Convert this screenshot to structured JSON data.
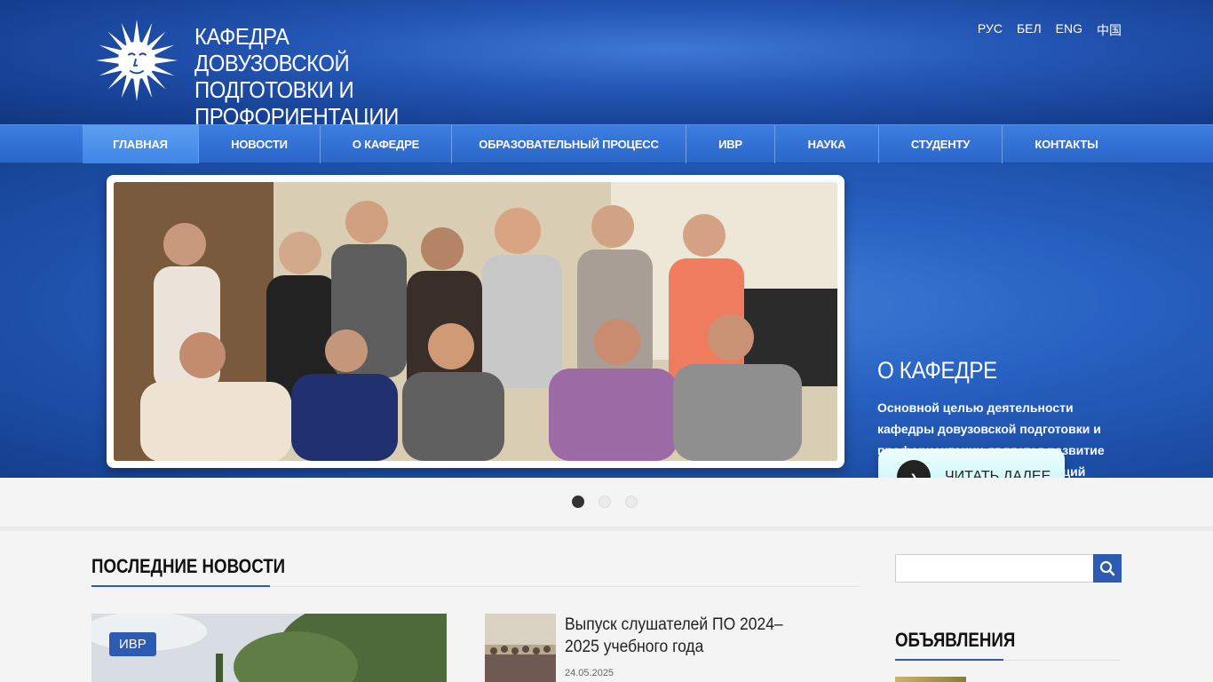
{
  "header": {
    "title_lines": [
      "КАФЕДРА ДОВУЗОВСКОЙ",
      "ПОДГОТОВКИ И",
      "ПРОФОРИЕНТАЦИИ"
    ],
    "languages": [
      "РУС",
      "БЕЛ",
      "ENG",
      "中国"
    ]
  },
  "nav": {
    "items": [
      {
        "label": "ГЛАВНАЯ",
        "active": true
      },
      {
        "label": "НОВОСТИ"
      },
      {
        "label": "О КАФЕДРЕ"
      },
      {
        "label": "ОБРАЗОВАТЕЛЬНЫЙ ПРОЦЕСС"
      },
      {
        "label": "ИВР"
      },
      {
        "label": "НАУКА"
      },
      {
        "label": "СТУДЕНТУ"
      },
      {
        "label": "КОНТАКТЫ"
      }
    ]
  },
  "hero": {
    "heading": "О КАФЕДРЕ",
    "text": "Основной целью деятельности кафедры довузовской подготовки и профориентации является развитие профессиональных компетенций слушателей подготовительного отделения и студентов.",
    "read_more": "ЧИТАТЬ ДАЛЕЕ",
    "slides_count": 3,
    "active_slide": 1
  },
  "news": {
    "section_title": "ПОСЛЕДНИЕ НОВОСТИ",
    "featured_tag": "ИВР",
    "items": [
      {
        "title": "Выпуск слушателей ПО 2024–2025 учебного года",
        "date": "24.05.2025"
      }
    ]
  },
  "sidebar": {
    "search_placeholder": "",
    "announcements_title": "ОБЪЯВЛЕНИЯ"
  },
  "colors": {
    "accent": "#2c5bb1",
    "header_blue": "#1d4ba3",
    "nav_blue": "#3573d6",
    "read_more_bg": "#c8f7f8"
  }
}
